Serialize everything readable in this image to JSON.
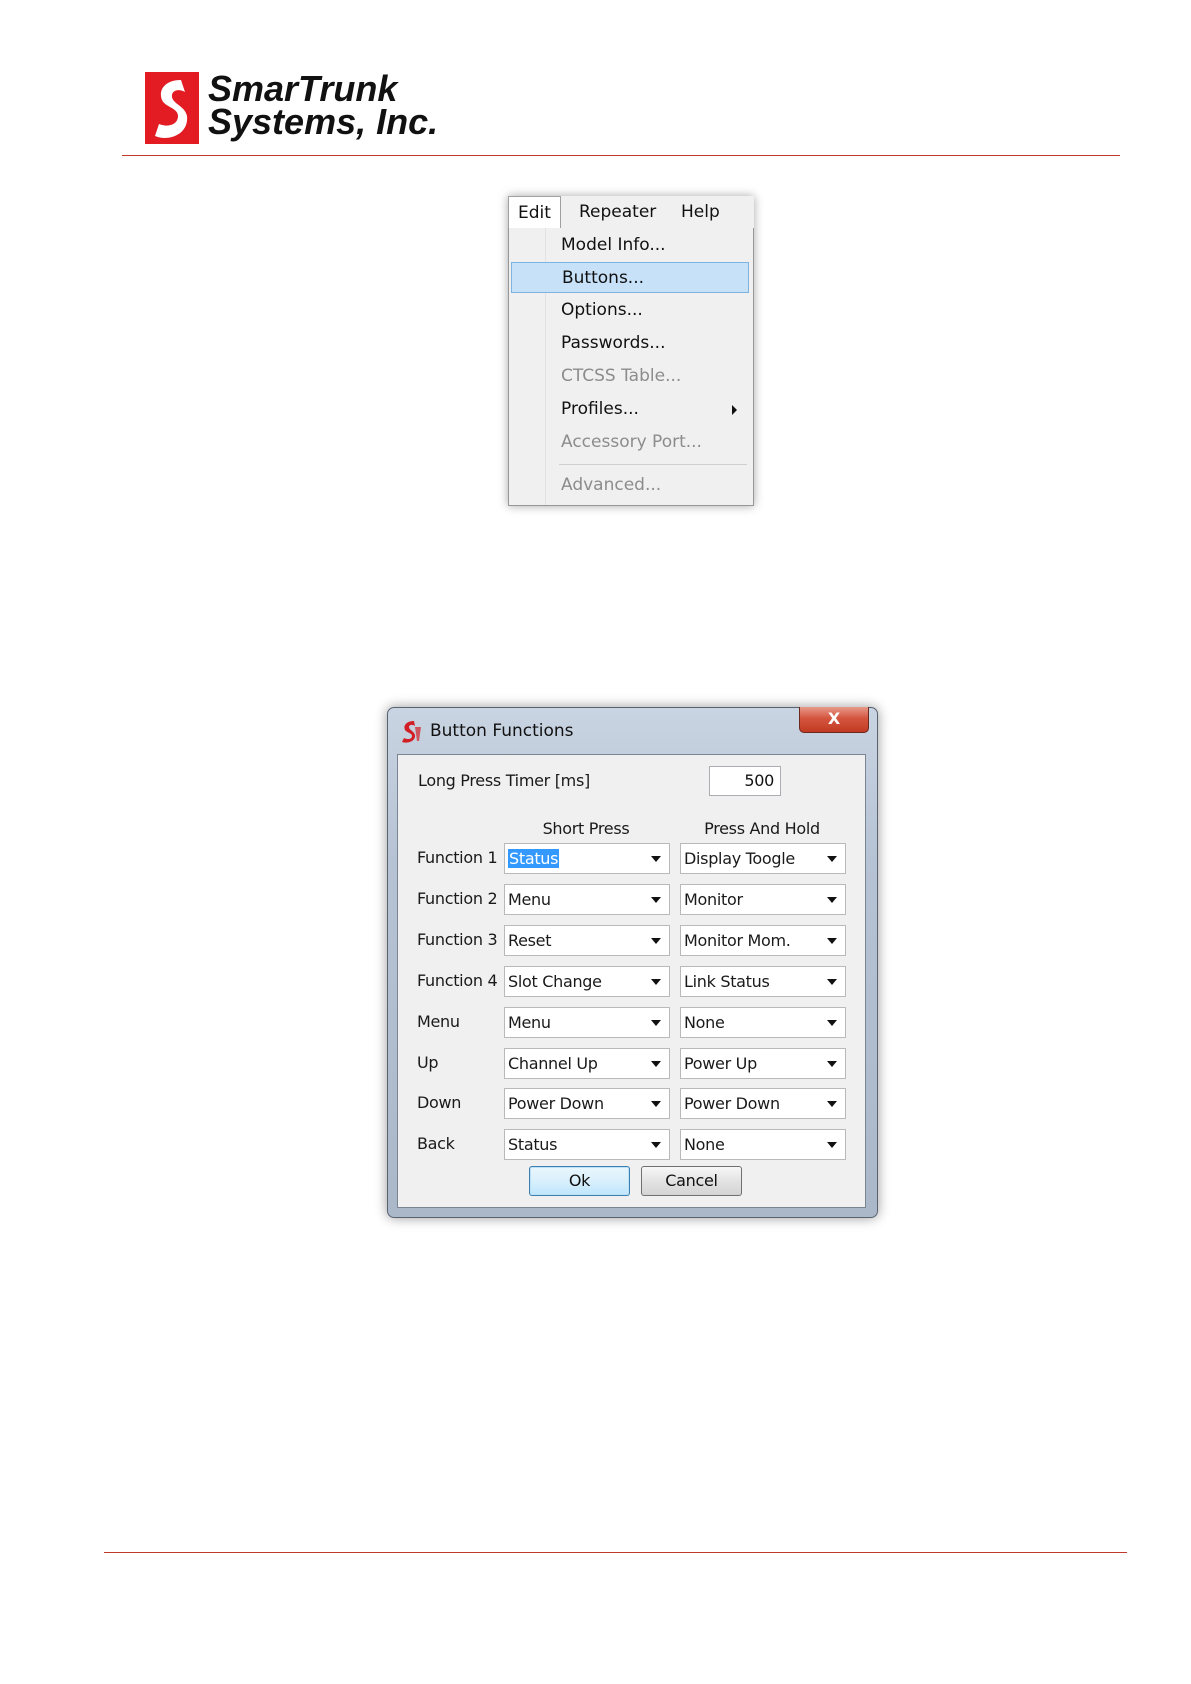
{
  "header": {
    "company_line1": "SmarTrunk",
    "company_line2": "Systems, Inc."
  },
  "menu_screenshot": {
    "menubar": [
      {
        "label": "Edit",
        "active": true
      },
      {
        "label": "Repeater",
        "active": false
      },
      {
        "label": "Help",
        "active": false
      }
    ],
    "items": [
      {
        "label": "Model Info...",
        "state": "enabled"
      },
      {
        "label": "Buttons...",
        "state": "highlighted"
      },
      {
        "label": "Options...",
        "state": "enabled"
      },
      {
        "label": "Passwords...",
        "state": "enabled"
      },
      {
        "label": "CTCSS Table...",
        "state": "disabled"
      },
      {
        "label": "Profiles...",
        "state": "enabled",
        "submenu": true
      },
      {
        "label": "Accessory Port...",
        "state": "disabled"
      },
      {
        "label": "Advanced...",
        "state": "disabled"
      }
    ]
  },
  "dialog": {
    "title": "Button Functions",
    "close_label": "X",
    "long_press": {
      "label": "Long Press Timer [ms]",
      "value": "500"
    },
    "columns": {
      "short": "Short Press",
      "hold": "Press And Hold"
    },
    "rows": [
      {
        "label": "Function 1",
        "short": "Status",
        "hold": "Display Toogle"
      },
      {
        "label": "Function 2",
        "short": "Menu",
        "hold": "Monitor"
      },
      {
        "label": "Function 3",
        "short": "Reset",
        "hold": "Monitor Mom."
      },
      {
        "label": "Function 4",
        "short": "Slot Change",
        "hold": "Link Status"
      },
      {
        "label": "Menu",
        "short": "Menu",
        "hold": "None"
      },
      {
        "label": "Up",
        "short": "Channel Up",
        "hold": "Power Up"
      },
      {
        "label": "Down",
        "short": "Power Down",
        "hold": "Power Down"
      },
      {
        "label": "Back",
        "short": "Status",
        "hold": "None"
      }
    ],
    "ok_label": "Ok",
    "cancel_label": "Cancel"
  },
  "colors": {
    "brand_red": "#e31b23",
    "menu_highlight": "#c6e1f8",
    "selection_blue": "#3399ff"
  }
}
